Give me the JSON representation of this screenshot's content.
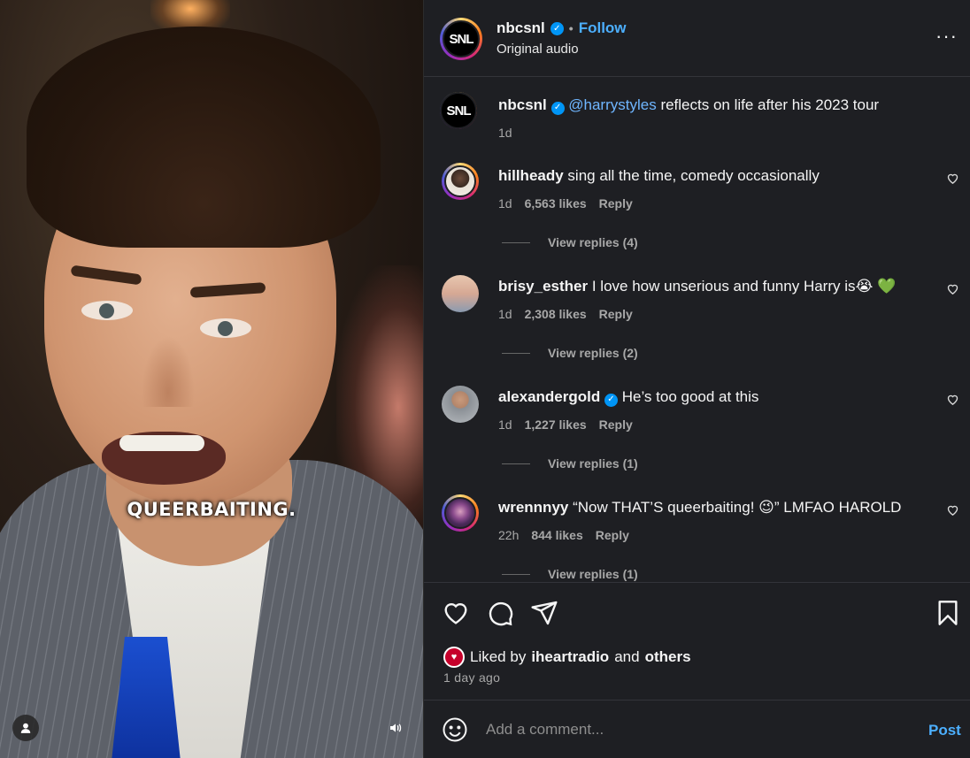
{
  "video": {
    "caption": "QUEERBAITING."
  },
  "header": {
    "username": "nbcsnl",
    "avatar_text": "SNL",
    "separator": "•",
    "follow_label": "Follow",
    "subtitle": "Original audio",
    "more_icon": "more-horizontal-icon",
    "more_label": "···"
  },
  "caption_post": {
    "username": "nbcsnl",
    "avatar_text": "SNL",
    "mention": "@harrystyles",
    "text": " reflects on life after his 2023 tour",
    "time": "1d"
  },
  "comments": [
    {
      "username": "hillheady",
      "text": " sing all the time, comedy occasionally",
      "time": "1d",
      "likes": "6,563 likes",
      "reply": "Reply",
      "view_replies": "View replies (4)",
      "verified": false
    },
    {
      "username": "brisy_esther",
      "text": " I love how unserious and funny Harry is😭 ",
      "emoji": "💚",
      "time": "1d",
      "likes": "2,308 likes",
      "reply": "Reply",
      "view_replies": "View replies (2)",
      "verified": false
    },
    {
      "username": "alexandergold",
      "text": " He’s too good at this",
      "time": "1d",
      "likes": "1,227 likes",
      "reply": "Reply",
      "view_replies": "View replies (1)",
      "verified": true
    },
    {
      "username": "wrennnyy",
      "text": " “Now THAT’S queerbaiting! 😉” LMFAO HAROLD",
      "time": "22h",
      "likes": "844 likes",
      "reply": "Reply",
      "view_replies": "View replies (1)",
      "verified": false
    }
  ],
  "actions": {
    "liked_prefix": "Liked by",
    "liked_user": "iheartradio",
    "liked_and": "and",
    "liked_others": "others",
    "date": "1 day ago"
  },
  "composer": {
    "placeholder": "Add a comment...",
    "post_label": "Post"
  },
  "colors": {
    "accent": "#4caffe",
    "panel_bg": "#1e1f23",
    "verified": "#0095f6"
  }
}
